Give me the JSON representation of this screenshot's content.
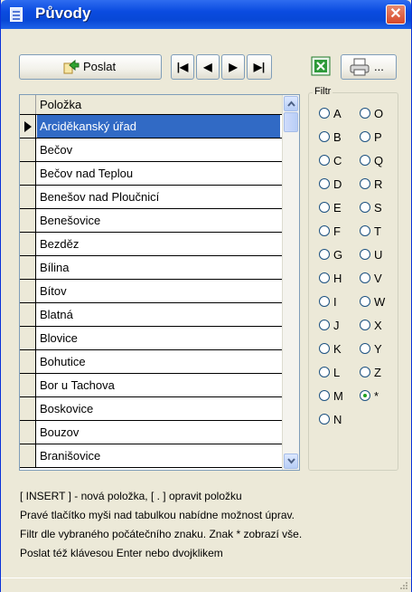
{
  "window": {
    "title": "Původy",
    "close_glyph": "✕"
  },
  "toolbar": {
    "send_label": "Poslat",
    "send_icon": "send-arrow-icon",
    "nav": [
      "|◀",
      "◀",
      "▶",
      "▶|"
    ],
    "print_suffix": "..."
  },
  "grid": {
    "header": "Položka",
    "selected_index": 0,
    "rows": [
      "Arciděkanský úřad",
      "Bečov",
      "Bečov nad Teplou",
      "Benešov nad Ploučnicí",
      "Benešovice",
      "Bezděz",
      "Bílina",
      "Bítov",
      "Blatná",
      "Blovice",
      "Bohutice",
      "Bor u Tachova",
      "Boskovice",
      "Bouzov",
      "Branišovice"
    ]
  },
  "filter": {
    "label": "Filtr",
    "left": [
      "A",
      "B",
      "C",
      "D",
      "E",
      "F",
      "G",
      "H",
      "I",
      "J",
      "K",
      "L",
      "M",
      "N"
    ],
    "right": [
      "O",
      "P",
      "Q",
      "R",
      "S",
      "T",
      "U",
      "V",
      "W",
      "X",
      "Y",
      "Z",
      "*"
    ],
    "selected": "*"
  },
  "help": [
    "[ INSERT ] - nová položka,  [ . ]  opravit položku",
    "Pravé  tlačítko myši nad  tabulkou nabídne možnost úprav.",
    "Filtr dle vybraného počátečního znaku. Znak * zobrazí vše.",
    "Poslat též klávesou Enter nebo dvojklikem"
  ],
  "colors": {
    "title_bar": "#0848d6",
    "selection": "#316ac5",
    "radio_dot": "#21a121"
  }
}
